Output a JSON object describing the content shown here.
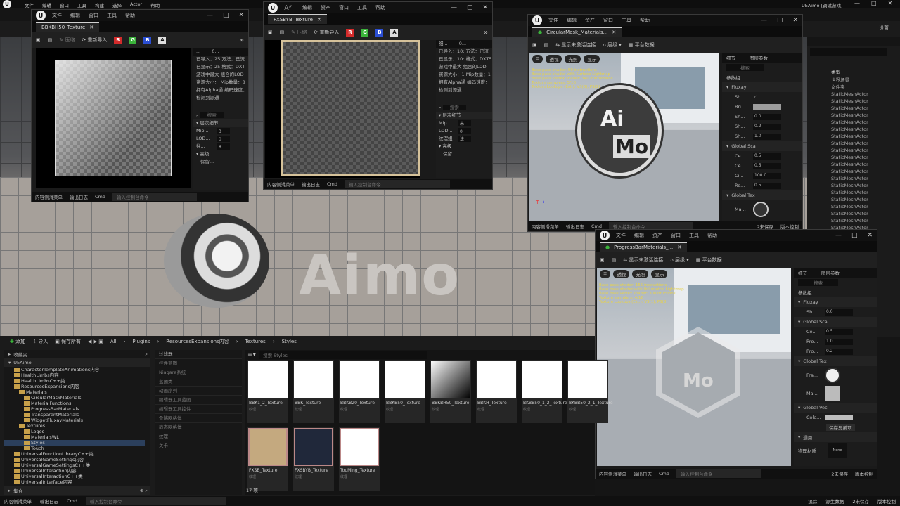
{
  "main": {
    "menu": [
      "文件",
      "编辑",
      "窗口",
      "工具",
      "构建",
      "选择",
      "Actor",
      "帮助"
    ],
    "title": "UEAimo [调试游戏]",
    "settings": "设置",
    "type_header": "类型",
    "outliner_types": [
      "世界场景",
      "文件夹",
      "StaticMeshActor",
      "StaticMeshActor",
      "StaticMeshActor",
      "StaticMeshActor",
      "StaticMeshActor",
      "StaticMeshActor",
      "StaticMeshActor",
      "StaticMeshActor",
      "StaticMeshActor",
      "StaticMeshActor",
      "StaticMeshActor",
      "StaticMeshActor",
      "StaticMeshActor",
      "StaticMeshActor",
      "StaticMeshActor",
      "StaticMeshActor",
      "StaticMeshActor",
      "StaticMeshActor",
      "StaticMeshActor",
      "StaticMeshActor",
      "StaticMeshActor"
    ],
    "outliner_types2": [
      "文件夹",
      "文件夹",
      "StaticMeshActor"
    ],
    "scene_text": "Aimo"
  },
  "win1": {
    "menu": [
      "文件",
      "编辑",
      "窗口",
      "工具",
      "帮助"
    ],
    "tab": "BBKBH50_Texture",
    "save": "",
    "compress": "压缩",
    "reimport": "重新导入",
    "channels": [
      "R",
      "G",
      "B",
      "A"
    ],
    "detail_tabs": [
      "...",
      "0..."
    ],
    "info": [
      [
        "已导入：25",
        "方法：已流"
      ],
      [
        "已显示：25",
        "格式：DXT"
      ],
      [
        "游戏中最大",
        "组合的LOD"
      ],
      [
        "资源大小：",
        "Mip数量：8"
      ],
      [
        "拥有Alpha通",
        "编码速度："
      ],
      [
        "检测到源通",
        ""
      ]
    ],
    "search": "搜索",
    "section": "层次细节",
    "rows": [
      [
        "Mip...",
        "3"
      ],
      [
        "LOD...",
        "0"
      ],
      [
        "往...",
        "8"
      ]
    ],
    "advanced": "高级",
    "keep": "保留..."
  },
  "win2": {
    "menu": [
      "文件",
      "编辑",
      "资产",
      "窗口",
      "工具",
      "帮助"
    ],
    "tab": "FXSBYB_Texture",
    "compress": "压缩",
    "reimport": "重新导入",
    "channels": [
      "R",
      "G",
      "B",
      "A"
    ],
    "detail_tabs": [
      "细...",
      "0..."
    ],
    "info": [
      [
        "已导入：10:",
        "方法：已流"
      ],
      [
        "已显示：10:",
        "格式：DXT5"
      ],
      [
        "游戏中最大",
        "组合的LOD"
      ],
      [
        "资源大小：1",
        "Mip数量：1"
      ],
      [
        "拥有Alpha通",
        "编码速度："
      ],
      [
        "检测到源通",
        ""
      ]
    ],
    "search": "搜索",
    "section": "层次细节",
    "rows": [
      [
        "Mip...",
        "未"
      ],
      [
        "LOD...",
        "0"
      ],
      [
        "纹理组",
        "法"
      ]
    ],
    "advanced": "高级",
    "keep": "保留..."
  },
  "win3": {
    "menu": [
      "文件",
      "编辑",
      "资产",
      "窗口",
      "工具",
      "帮助"
    ],
    "tab": "CircularMask_Materials...",
    "show_inactive": "显示未激活连接",
    "hierarchy": "层级",
    "platform": "平台数据",
    "vp_btns": [
      "透视",
      "光照",
      "显示"
    ],
    "stats": [
      "Base pass shader: 59 instructions",
      "Base pass shader with Surface Lightmap",
      "Base pass vertex shader: 340 instructions",
      "Texture samplers: 5/16",
      "Texture Lookups (Est.): VS(0), PS(2)"
    ],
    "detail_tab": "细节",
    "param_tab": "图层参数",
    "search": "搜索",
    "param_group": "参数组",
    "groups": [
      "Fluxay",
      "Global Sca",
      "Global Tex"
    ],
    "fluxay_rows": [
      "Sh...",
      "Bri...",
      "Sh...",
      "Sh...",
      "Sh..."
    ],
    "fluxay_vals": [
      "",
      "",
      "0.0",
      "0.2",
      "1.0"
    ],
    "scale_rows": [
      "Ce...",
      "Ce...",
      "Ci...",
      "Ro..."
    ],
    "scale_vals": [
      "0.5",
      "0.5",
      "100.0",
      "0.5"
    ],
    "tex_row": "Ma...",
    "logo_top": "Ai",
    "logo_bottom": "Mo",
    "status": [
      "内容侧滑菜单",
      "输出日志",
      "Cmd",
      "输入控制台命令",
      "2未保存",
      "版本控制"
    ]
  },
  "win4": {
    "menu": [
      "文件",
      "编辑",
      "资产",
      "窗口",
      "工具",
      "帮助"
    ],
    "tab": "ProgressBarMaterials_...",
    "show_inactive": "显示未激活连接",
    "hierarchy": "层级",
    "platform": "平台数据",
    "vp_btns": [
      "透视",
      "光照",
      "显示"
    ],
    "stats": [
      "Base pass shader: 155 instructions",
      "Base pass shader with Volumetric Lightmap",
      "Base pass vertex shader: 3 instructions",
      "Texture samplers: 4/16",
      "Texture Lookups (Est.): VS(1), PS(3)"
    ],
    "detail_tab": "细节",
    "param_tab": "图层参数",
    "search": "搜索",
    "param_group": "参数组",
    "groups": [
      "Fluxay",
      "Global Sca",
      "Global Tex",
      "Global Vec",
      "通用"
    ],
    "fluxay_row": [
      "Sh...",
      "0.0"
    ],
    "scale_rows": [
      [
        "Ce...",
        "0.5"
      ],
      [
        "Pro...",
        "1.0"
      ],
      [
        "Pro...",
        "0.2"
      ]
    ],
    "tex_rows": [
      "Fra...",
      "Ma..."
    ],
    "vec_row": "Colo...",
    "save_siblings": "保存兄弟项",
    "phys": "物理材质",
    "none": "None",
    "logo": "Mo",
    "status": [
      "内容侧滑菜单",
      "输出日志",
      "Cmd",
      "输入控制台命令",
      "2未保存",
      "版本控制"
    ]
  },
  "cb": {
    "add": "添加",
    "import": "导入",
    "save_all": "保存所有",
    "path": [
      "All",
      "Plugins",
      "ResourcesExpansions内容",
      "Textures",
      "Styles"
    ],
    "fav": "收藏夹",
    "root": "UEAimo",
    "tree": [
      [
        "CharacterTemplateAnimations内容",
        2
      ],
      [
        "HealthLimbs内容",
        2
      ],
      [
        "HealthLimbsC++类",
        2
      ],
      [
        "ResourcesExpansions内容",
        2
      ],
      [
        "Materials",
        3
      ],
      [
        "CircularMaskMaterials",
        4
      ],
      [
        "MaterialFunctions",
        4
      ],
      [
        "ProgressBarMaterials",
        4
      ],
      [
        "TransparentMaterials",
        4
      ],
      [
        "WidgetFluxayMaterials",
        4
      ],
      [
        "Textures",
        3
      ],
      [
        "Logos",
        4
      ],
      [
        "MaterialsWL",
        4
      ],
      [
        "Styles",
        4
      ],
      [
        "Touch",
        4
      ],
      [
        "UniversalFunctionLibraryC++类",
        2
      ],
      [
        "UniversalGameSettings内容",
        2
      ],
      [
        "UniversalGameSettingsC++类",
        2
      ],
      [
        "UniversalInteraction内容",
        2
      ],
      [
        "UniversalInteractionC++类",
        2
      ],
      [
        "UniversalInterface内容",
        2
      ]
    ],
    "collection": "集合",
    "filter_hdr": "过滤器",
    "filters": [
      "控件蓝图",
      "Niagara系统",
      "蓝图类",
      "动画序列",
      "编辑器工具蓝图",
      "编辑器工具控件",
      "骨骼网格体",
      "静态网格体",
      "纹理",
      "关卡"
    ],
    "search_ph": "搜索 Styles",
    "assets": [
      [
        "BBK1_2_Texture",
        "纹理"
      ],
      [
        "BBK_Texture",
        "纹理"
      ],
      [
        "BBKB20_Texture",
        "纹理"
      ],
      [
        "BBKB50_Texture",
        "纹理"
      ],
      [
        "BBKBH50_Texture",
        "纹理"
      ],
      [
        "BBKH_Texture",
        "纹理"
      ],
      [
        "BKBB50_1_2_Texture",
        "纹理"
      ],
      [
        "BKBB50_2_1_Texture",
        "纹理"
      ],
      [
        "FXSB_Texture",
        "纹理"
      ],
      [
        "FXSBYB_Texture",
        "纹理"
      ],
      [
        "TouMing_Texture",
        "纹理"
      ]
    ],
    "count": "17 项"
  },
  "bottom": {
    "items": [
      "内容侧滑菜单",
      "输出日志",
      "Cmd",
      "输入控制台命令"
    ],
    "right": [
      "追踪",
      "源生数据",
      "2未保存",
      "版本控制"
    ]
  }
}
